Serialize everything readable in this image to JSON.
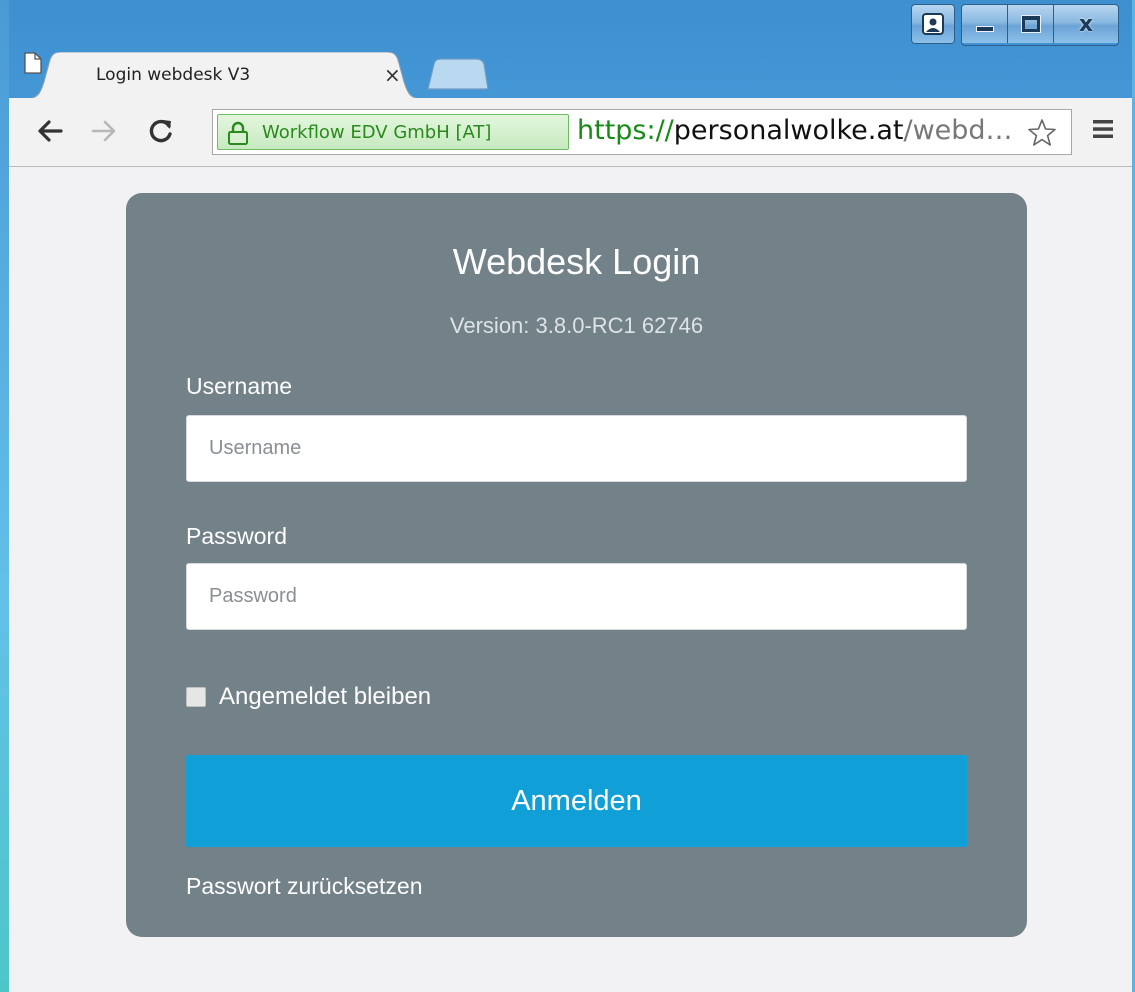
{
  "browser": {
    "tab": {
      "title": "Login webdesk V3",
      "close_glyph": "×"
    },
    "toolbar": {
      "back_icon": "back-arrow-icon",
      "forward_icon": "forward-arrow-icon",
      "reload_icon": "reload-icon",
      "ev_certificate": "Workflow EDV GmbH [AT]",
      "url_scheme": "https://",
      "url_host": "personalwolke.at",
      "url_path": "/webd…"
    },
    "caption": {
      "close_glyph": "x"
    }
  },
  "login": {
    "title": "Webdesk Login",
    "version": "Version: 3.8.0-RC1 62746",
    "username_label": "Username",
    "username_placeholder": "Username",
    "username_value": "",
    "password_label": "Password",
    "password_placeholder": "Password",
    "password_value": "",
    "remember_label": "Angemeldet bleiben",
    "remember_checked": false,
    "submit_label": "Anmelden",
    "reset_link": "Passwort zurücksetzen"
  },
  "colors": {
    "card_background": "#738188",
    "button_primary": "#109fd6",
    "page_background": "#f2f2f4",
    "ev_green": "#2a8a1d"
  }
}
